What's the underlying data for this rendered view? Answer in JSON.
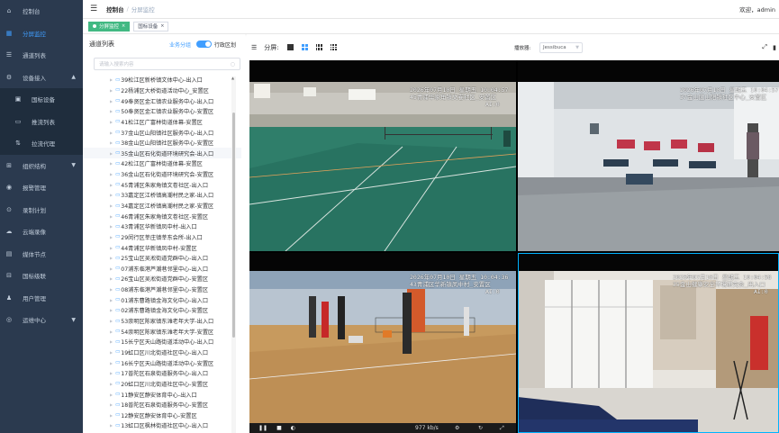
{
  "sidebar": {
    "items": [
      {
        "icon": "dashboard-icon",
        "glyph": "⌂",
        "label": "控制台",
        "active": false,
        "sub": false,
        "chevron": ""
      },
      {
        "icon": "split-screen-icon",
        "glyph": "▦",
        "label": "分屏监控",
        "active": true,
        "sub": false,
        "chevron": ""
      },
      {
        "icon": "channel-list-icon",
        "glyph": "☰",
        "label": "通道列表",
        "active": false,
        "sub": false,
        "chevron": ""
      },
      {
        "icon": "device-access-icon",
        "glyph": "⚙",
        "label": "设备接入",
        "active": false,
        "sub": false,
        "chevron": "▲"
      },
      {
        "icon": "national-device-icon",
        "glyph": "▣",
        "label": "国标设备",
        "active": false,
        "sub": true,
        "chevron": ""
      },
      {
        "icon": "push-list-icon",
        "glyph": "▭",
        "label": "推流列表",
        "active": false,
        "sub": true,
        "chevron": ""
      },
      {
        "icon": "pull-proxy-icon",
        "glyph": "⇅",
        "label": "拉流代理",
        "active": false,
        "sub": true,
        "chevron": ""
      },
      {
        "icon": "org-structure-icon",
        "glyph": "⊞",
        "label": "组织结构",
        "active": false,
        "sub": false,
        "chevron": "▼"
      },
      {
        "icon": "alarm-icon",
        "glyph": "◉",
        "label": "报警管理",
        "active": false,
        "sub": false,
        "chevron": ""
      },
      {
        "icon": "record-plan-icon",
        "glyph": "⊙",
        "label": "录制计划",
        "active": false,
        "sub": false,
        "chevron": ""
      },
      {
        "icon": "cloud-record-icon",
        "glyph": "☁",
        "label": "云端录像",
        "active": false,
        "sub": false,
        "chevron": ""
      },
      {
        "icon": "media-node-icon",
        "glyph": "▤",
        "label": "媒体节点",
        "active": false,
        "sub": false,
        "chevron": ""
      },
      {
        "icon": "cascade-icon",
        "glyph": "⊟",
        "label": "国标级联",
        "active": false,
        "sub": false,
        "chevron": ""
      },
      {
        "icon": "user-icon",
        "glyph": "♟",
        "label": "用户管理",
        "active": false,
        "sub": false,
        "chevron": ""
      },
      {
        "icon": "ops-center-icon",
        "glyph": "◎",
        "label": "运维中心",
        "active": false,
        "sub": false,
        "chevron": "▼"
      }
    ]
  },
  "header": {
    "breadcrumb_1": "控制台",
    "breadcrumb_sep": "/",
    "breadcrumb_2": "分屏监控",
    "welcome": "欢迎，admin"
  },
  "tags": {
    "active_label": "分屏监控",
    "other_label": "国标设备",
    "close": "×"
  },
  "channel_panel": {
    "title": "通道列表",
    "opt_business": "业务分组",
    "opt_region": "行政区划",
    "search_placeholder": "请输入搜索内容",
    "items": [
      "39松江区新桥镇文体中心-出入口",
      "22杨浦区大桥街道活动中心_安置区",
      "49奉贤区金汇镇农业服务中心-出入口",
      "50奉贤区金汇镇农业服务中心-安置区",
      "41松江区广富林街道体幕-安置区",
      "37金山区山阳镇社区服务中心-出入口",
      "38金山区山阳镇社区服务中心-安置区",
      "35金山区石化街道环境研究会-出入口",
      "42松江区广富林街道体幕-安置区",
      "36金山区石化街道环境研究会-安置区",
      "45青浦区朱家角镇文卷社区-出入口",
      "33嘉定区江桥镇高潮村民之家-出入口",
      "34嘉定区江桥镇高潮村民之家-安置区",
      "46青浦区朱家角镇文卷社区-安置区",
      "43青浦区华新镇凤中村-出入口",
      "29闵行区莘庄镇莘东会所-出入口",
      "44青浦区华新镇凤中村-安置区",
      "25宝山区吴淞街道党群中心-出入口",
      "07浦东临港芦潮巷邻里中心-出入口",
      "26宝山区吴淞街道党群中心-安置区",
      "08浦东临港芦潮巷邻里中心-安置区",
      "01浦东曹路镇金海文化中心-出入口",
      "02浦东曹路镇金海文化中心-安置区",
      "53崇明区陈家镇东滩老年大学-出入口",
      "54崇明区陈家镇东滩老年大学-安置区",
      "15长宁区天山路街道活动中心-出入口",
      "19虹口区川北街道社区中心-出入口",
      "16长宁区天山路街道活动中心-安置区",
      "17普陀区石泉街道服务中心-出入口",
      "20虹口区川北街道社区中心-安置区",
      "11静安区静安体育中心-出入口",
      "18普陀区石泉街道服务中心-安置区",
      "12静安区静安体育中心-安置区",
      "13虹口区枫林街道社区中心-出入口"
    ]
  },
  "video_toolbar": {
    "list_icon": "☰",
    "split_label": "分屏:",
    "player_label": "播放器:",
    "player_value": "Jessibuca"
  },
  "videos": [
    {
      "osd_time": "2026年07月10日 星期五 10:04:57",
      "osd_name": "45青浦华家角镇文卷社区_安置区",
      "osd_extra": "AI:0"
    },
    {
      "osd_time": "2026年07月10日 星期五 10:04:57",
      "osd_name": "37金山区山阳镇社区中心_安置区",
      "osd_extra": ""
    },
    {
      "osd_time": "2026年07月10日 星期五 10:04:36",
      "osd_name": "43青浦区华新镇凤中村_安置区",
      "osd_extra": "AI:0"
    },
    {
      "osd_time": "2026年07月10日 星期五 10:04:58",
      "osd_name": "35金山健康安全环境研究会_出入口",
      "osd_extra": "AI:0"
    }
  ],
  "video_bar": {
    "play": "❚❚",
    "stop": "■",
    "audio": "◐",
    "rate": "977 kb/s",
    "snapshot": "⚙",
    "refresh": "↻",
    "fullscreen": "⤢"
  },
  "colors": {
    "sidebar_bg": "#2b3a4f",
    "active_blue": "#409eff",
    "tag_green": "#42b983",
    "selected_cell": "#00b4ff"
  }
}
